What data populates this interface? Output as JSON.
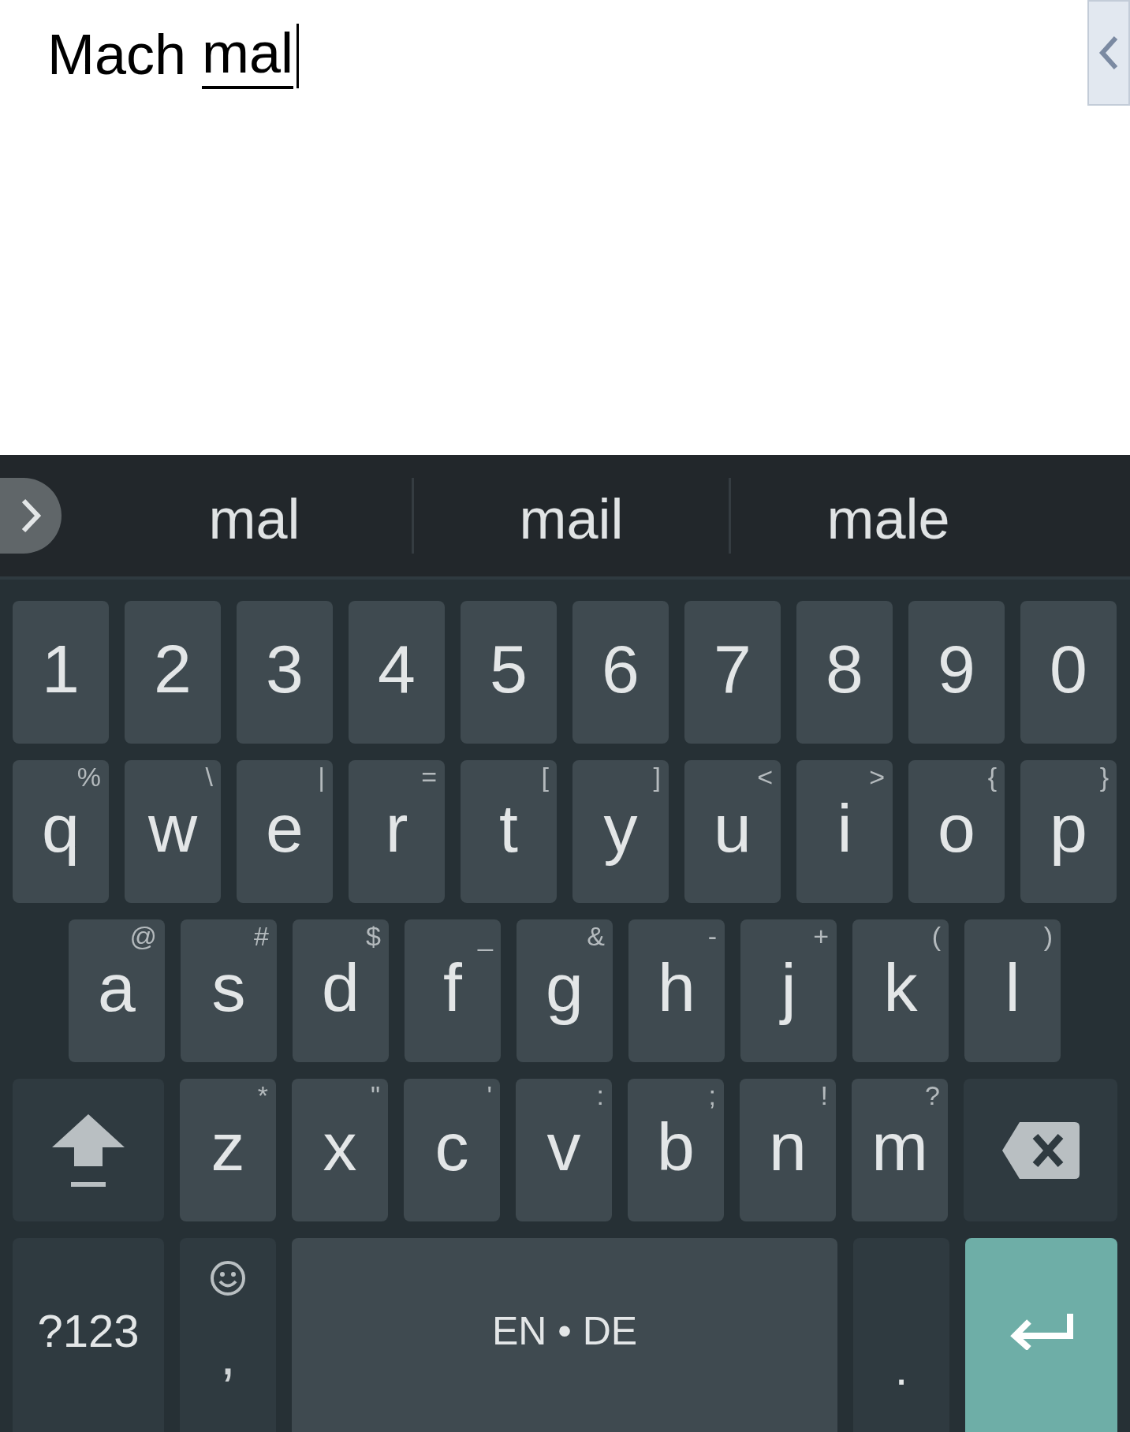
{
  "editor": {
    "text": "Mach ",
    "composing": "mal"
  },
  "suggestions": [
    "mal",
    "mail",
    "male"
  ],
  "keyboard": {
    "digits": [
      "1",
      "2",
      "3",
      "4",
      "5",
      "6",
      "7",
      "8",
      "9",
      "0"
    ],
    "letter_rows": [
      [
        {
          "label": "q",
          "hint": "%"
        },
        {
          "label": "w",
          "hint": "\\"
        },
        {
          "label": "e",
          "hint": "|"
        },
        {
          "label": "r",
          "hint": "="
        },
        {
          "label": "t",
          "hint": "["
        },
        {
          "label": "y",
          "hint": "]"
        },
        {
          "label": "u",
          "hint": "<"
        },
        {
          "label": "i",
          "hint": ">"
        },
        {
          "label": "o",
          "hint": "{"
        },
        {
          "label": "p",
          "hint": "}"
        }
      ],
      [
        {
          "label": "a",
          "hint": "@"
        },
        {
          "label": "s",
          "hint": "#"
        },
        {
          "label": "d",
          "hint": "$"
        },
        {
          "label": "f",
          "hint": "_"
        },
        {
          "label": "g",
          "hint": "&"
        },
        {
          "label": "h",
          "hint": "-"
        },
        {
          "label": "j",
          "hint": "+"
        },
        {
          "label": "k",
          "hint": "("
        },
        {
          "label": "l",
          "hint": ")"
        }
      ],
      [
        {
          "label": "z",
          "hint": "*"
        },
        {
          "label": "x",
          "hint": "\""
        },
        {
          "label": "c",
          "hint": "'"
        },
        {
          "label": "v",
          "hint": ":"
        },
        {
          "label": "b",
          "hint": ";"
        },
        {
          "label": "n",
          "hint": "!"
        },
        {
          "label": "m",
          "hint": "?"
        }
      ]
    ],
    "symbols_key": "?123",
    "comma_key": ",",
    "space_key": "EN • DE",
    "period_key": "."
  }
}
